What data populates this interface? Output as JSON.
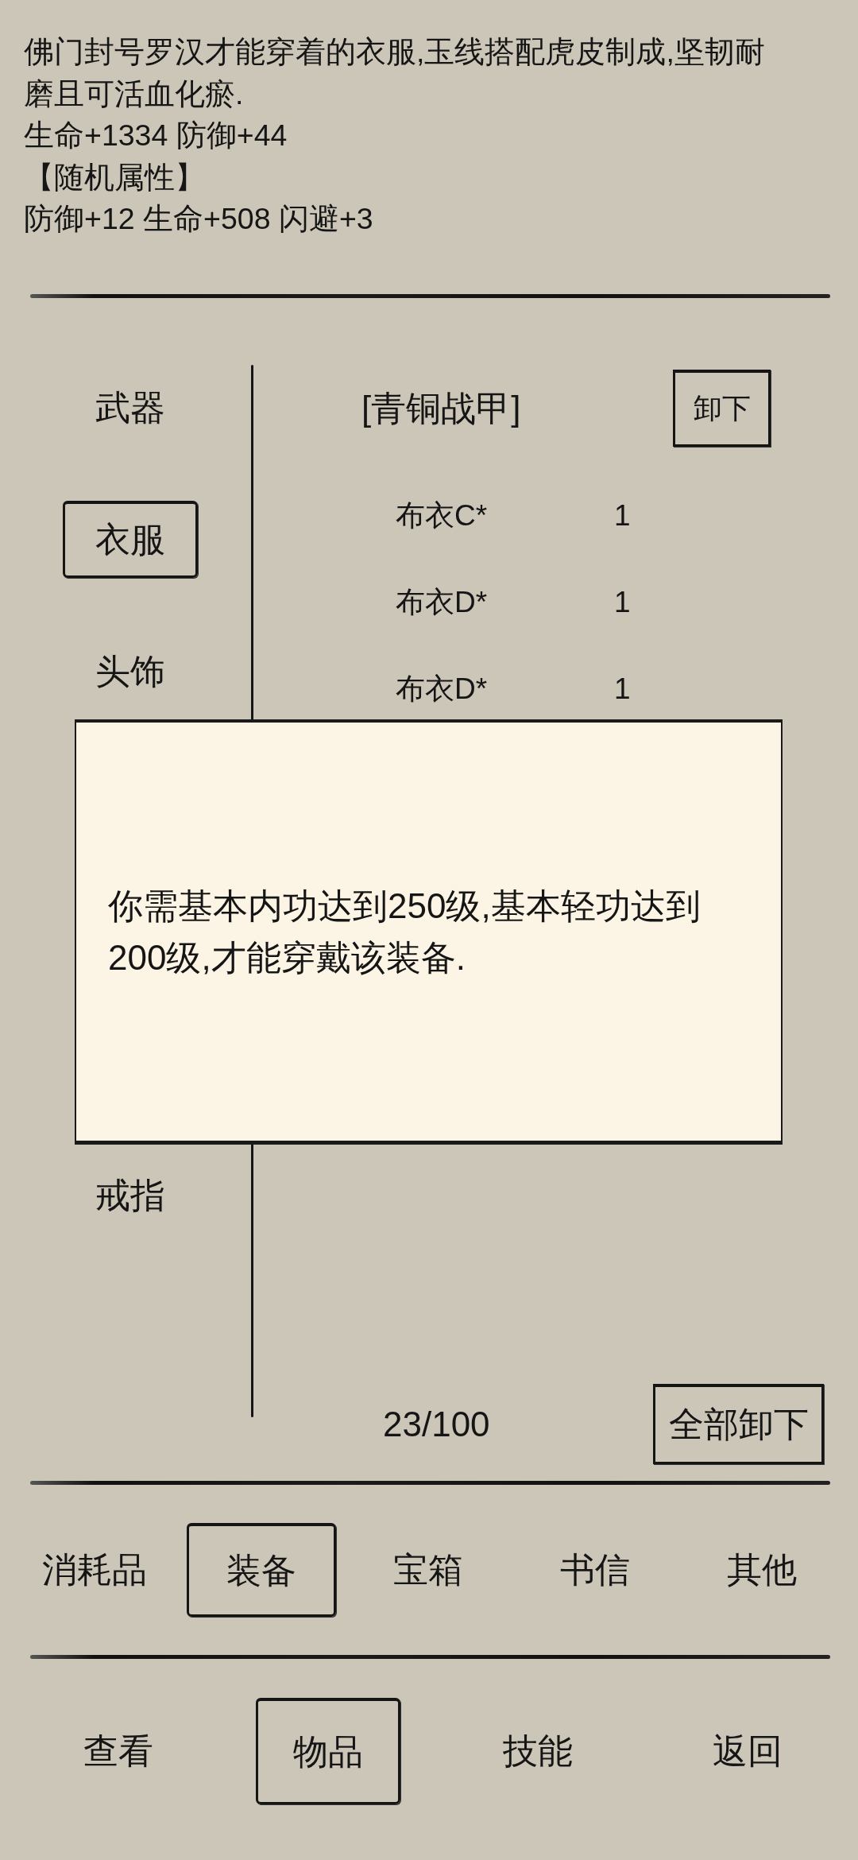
{
  "item_description": {
    "text": "佛门封号罗汉才能穿着的衣服,玉线搭配虎皮制成,坚韧耐磨且可活血化瘀.",
    "base_stats": "生命+1334 防御+44",
    "random_header": "【随机属性】",
    "random_stats": "防御+12 生命+508 闪避+3"
  },
  "slots": [
    {
      "label": "武器",
      "selected": false
    },
    {
      "label": "衣服",
      "selected": true
    },
    {
      "label": "头饰",
      "selected": false
    },
    {
      "label": "戒指",
      "selected": false
    }
  ],
  "equipped": {
    "name": "[青铜战甲]",
    "unequip_button": "卸下"
  },
  "items": [
    {
      "name": "布衣C*",
      "count": "1"
    },
    {
      "name": "布衣D*",
      "count": "1"
    },
    {
      "name": "布衣D*",
      "count": "1"
    }
  ],
  "capacity": "23/100",
  "unequip_all_button": "全部卸下",
  "dialog": {
    "message": "你需基本内功达到250级,基本轻功达到200级,才能穿戴该装备."
  },
  "category_tabs": [
    {
      "label": "消耗品",
      "selected": false
    },
    {
      "label": "装备",
      "selected": true
    },
    {
      "label": "宝箱",
      "selected": false
    },
    {
      "label": "书信",
      "selected": false
    },
    {
      "label": "其他",
      "selected": false
    }
  ],
  "bottom_nav": [
    {
      "label": "查看",
      "selected": false
    },
    {
      "label": "物品",
      "selected": true
    },
    {
      "label": "技能",
      "selected": false
    },
    {
      "label": "返回",
      "selected": false
    }
  ]
}
